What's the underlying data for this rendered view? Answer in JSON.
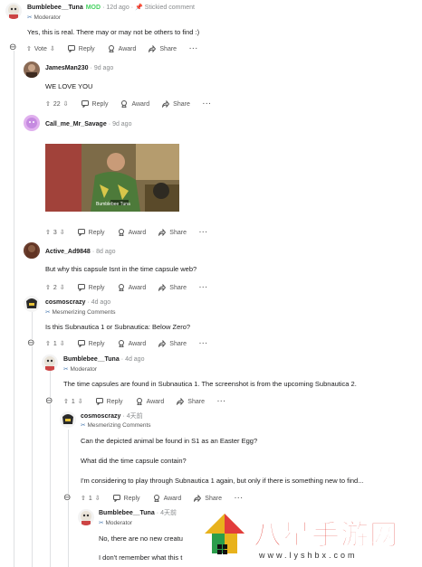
{
  "comments": [
    {
      "author": "Bumblebee__Tuna",
      "badge": "MOD",
      "time": "12d ago",
      "stickied": "Stickied comment",
      "flair": "Moderator",
      "body": [
        "Yes, this is real. There may or may not be others to find :)"
      ],
      "score": "Vote"
    },
    {
      "author": "JamesMan230",
      "time": "9d ago",
      "body": [
        "WE LOVE YOU"
      ],
      "score": "22"
    },
    {
      "author": "Call_me_Mr_Savage",
      "time": "9d ago",
      "body": [],
      "image_caption": "Bumblebee Tuna",
      "score": "3"
    },
    {
      "author": "Active_Ad9848",
      "time": "8d ago",
      "body": [
        "But why this capsule Isnt in the time capsule web?"
      ],
      "score": "2"
    },
    {
      "author": "cosmoscrazy",
      "time": "4d ago",
      "flair": "Mesmerizing Comments",
      "body": [
        "Is this Subnautica 1 or Subnautica: Below Zero?"
      ],
      "score": "1"
    },
    {
      "author": "Bumblebee__Tuna",
      "time": "4d ago",
      "flair": "Moderator",
      "body": [
        "The time capsules are found in Subnautica 1. The screenshot is from the upcoming Subnautica 2."
      ],
      "score": "1"
    },
    {
      "author": "cosmoscrazy",
      "time": "4天前",
      "flair": "Mesmerizing Comments",
      "body": [
        "Can the depicted animal be found in S1 as an Easter Egg?",
        "What did the time capsule contain?",
        "I'm considering to play through Subnautica 1 again, but only if there is something new to find..."
      ],
      "score": "1"
    },
    {
      "author": "Bumblebee__Tuna",
      "time": "4天前",
      "flair": "Moderator",
      "body": [
        "No, there are no new creatu",
        "I don't remember what this t"
      ]
    }
  ],
  "labels": {
    "reply": "Reply",
    "award": "Award",
    "share": "Share",
    "more": "···",
    "collapse": "⊖"
  },
  "watermark": {
    "text": "八星手游网",
    "url": "www.lyshbx.com"
  },
  "colors": {
    "mod": "#46d160",
    "thread": "#dfe1e3",
    "meta": "#878a8c"
  }
}
